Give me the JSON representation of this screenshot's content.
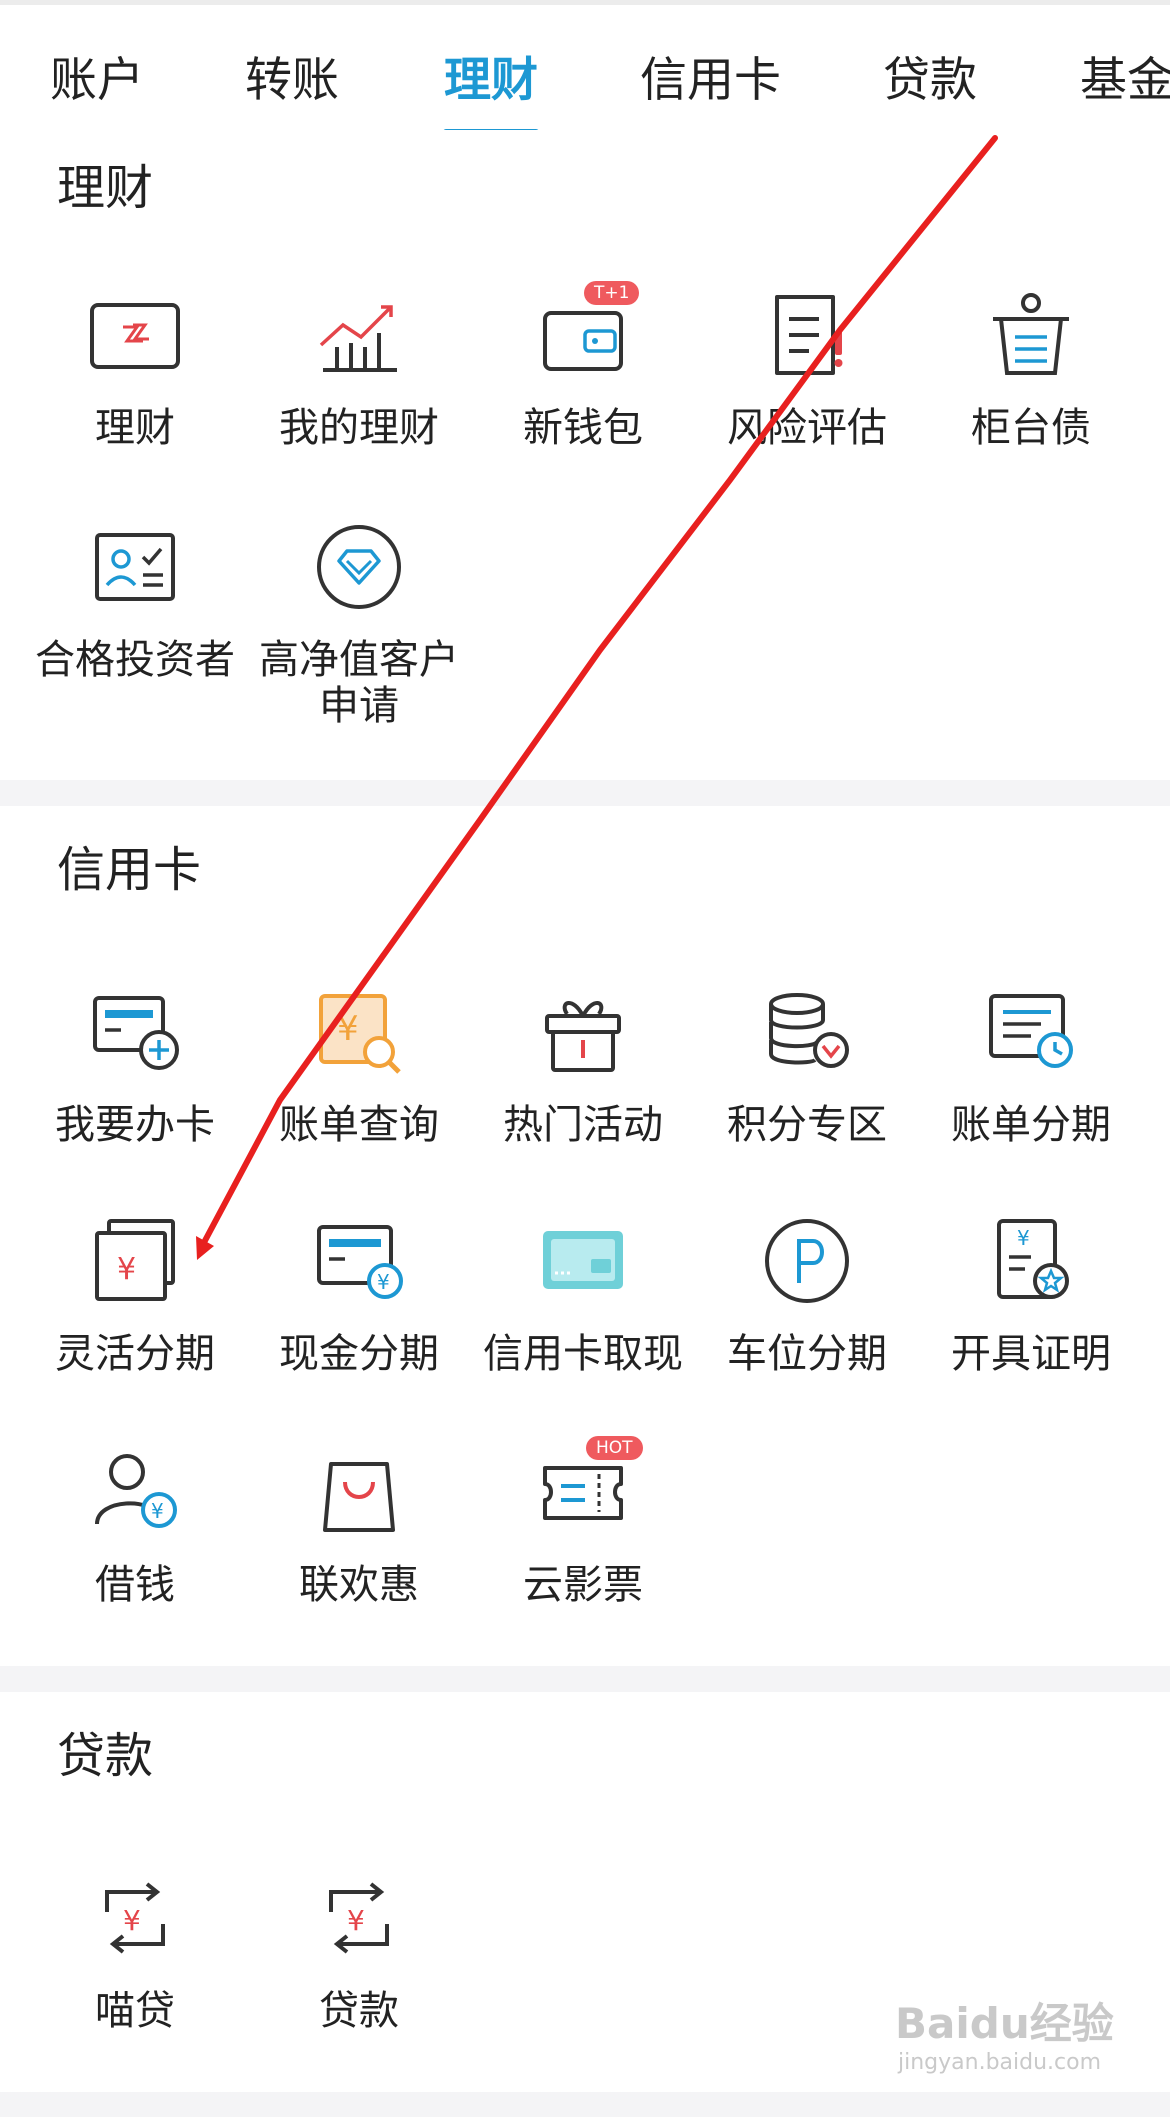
{
  "tabs": [
    {
      "label": "账户"
    },
    {
      "label": "转账"
    },
    {
      "label": "理财"
    },
    {
      "label": "信用卡"
    },
    {
      "label": "贷款"
    },
    {
      "label": "基金"
    }
  ],
  "sections": {
    "licai": {
      "title": "理财",
      "items": [
        {
          "label": "理财"
        },
        {
          "label": "我的理财"
        },
        {
          "label": "新钱包",
          "badge": "T+1"
        },
        {
          "label": "风险评估"
        },
        {
          "label": "柜台债"
        },
        {
          "label": "合格投资者"
        },
        {
          "label": "高净值客户申请"
        }
      ]
    },
    "credit": {
      "title": "信用卡",
      "items": [
        {
          "label": "我要办卡"
        },
        {
          "label": "账单查询"
        },
        {
          "label": "热门活动"
        },
        {
          "label": "积分专区"
        },
        {
          "label": "账单分期"
        },
        {
          "label": "灵活分期"
        },
        {
          "label": "现金分期"
        },
        {
          "label": "信用卡取现"
        },
        {
          "label": "车位分期"
        },
        {
          "label": "开具证明"
        },
        {
          "label": "借钱"
        },
        {
          "label": "联欢惠"
        },
        {
          "label": "云影票",
          "badge": "HOT"
        }
      ]
    },
    "loan": {
      "title": "贷款",
      "items": [
        {
          "label": "喵贷"
        },
        {
          "label": "贷款"
        }
      ]
    }
  },
  "watermark": {
    "text": "Baidu经验",
    "sub": "jingyan.baidu.com"
  },
  "colors": {
    "accent": "#1d98d3",
    "red": "#e4454a",
    "annotation": "#e8201f"
  }
}
